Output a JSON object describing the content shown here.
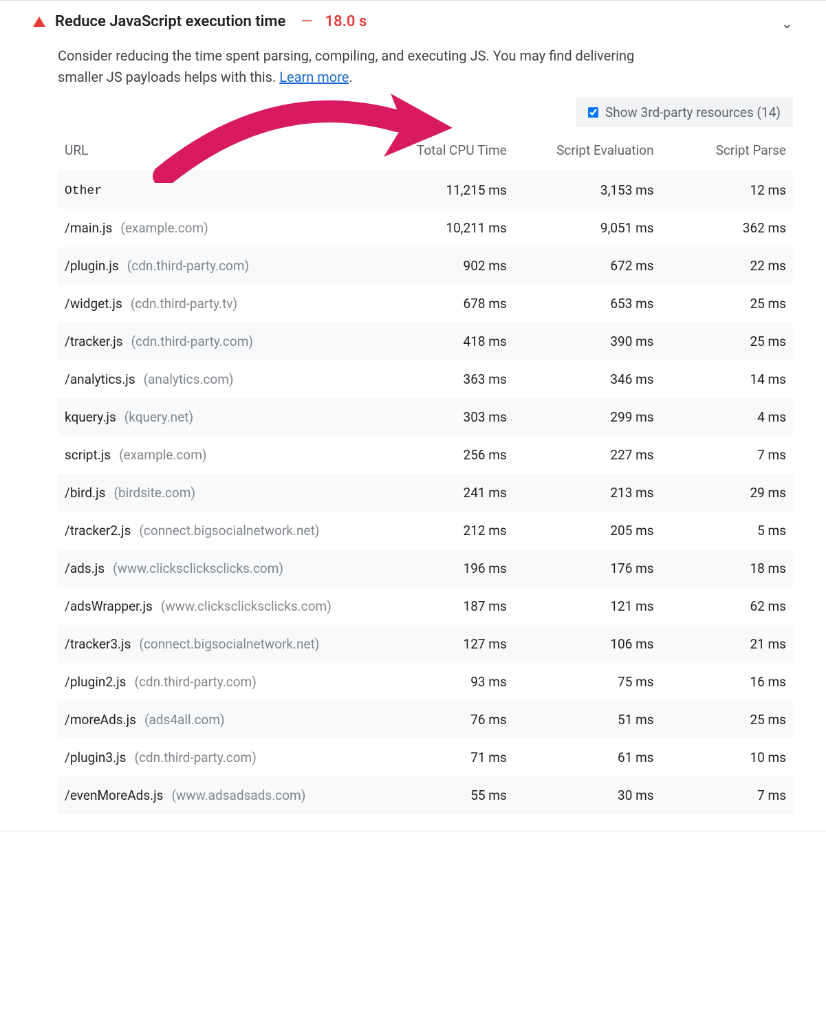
{
  "audit": {
    "title": "Reduce JavaScript execution time",
    "metric": "18.0 s",
    "description_pre": "Consider reducing the time spent parsing, compiling, and executing JS. You may find delivering smaller JS payloads helps with this. ",
    "learn_more": "Learn more",
    "toggle_label": "Show 3rd-party resources (14)"
  },
  "columns": {
    "url": "URL",
    "cpu": "Total CPU Time",
    "eval": "Script Evaluation",
    "parse": "Script Parse"
  },
  "rows": [
    {
      "path": "Other",
      "host": "",
      "mono": true,
      "cpu": "11,215 ms",
      "eval": "3,153 ms",
      "parse": "12 ms"
    },
    {
      "path": "/main.js",
      "host": "(example.com)",
      "cpu": "10,211 ms",
      "eval": "9,051 ms",
      "parse": "362 ms"
    },
    {
      "path": "/plugin.js",
      "host": "(cdn.third-party.com)",
      "cpu": "902 ms",
      "eval": "672 ms",
      "parse": "22 ms"
    },
    {
      "path": "/widget.js",
      "host": "(cdn.third-party.tv)",
      "cpu": "678 ms",
      "eval": "653 ms",
      "parse": "25 ms"
    },
    {
      "path": "/tracker.js",
      "host": "(cdn.third-party.com)",
      "cpu": "418 ms",
      "eval": "390 ms",
      "parse": "25 ms"
    },
    {
      "path": "/analytics.js",
      "host": "(analytics.com)",
      "cpu": "363 ms",
      "eval": "346 ms",
      "parse": "14 ms"
    },
    {
      "path": "kquery.js",
      "host": "(kquery.net)",
      "cpu": "303 ms",
      "eval": "299 ms",
      "parse": "4 ms"
    },
    {
      "path": "script.js",
      "host": "(example.com)",
      "cpu": "256 ms",
      "eval": "227 ms",
      "parse": "7 ms"
    },
    {
      "path": "/bird.js",
      "host": "(birdsite.com)",
      "cpu": "241 ms",
      "eval": "213 ms",
      "parse": "29 ms"
    },
    {
      "path": "/tracker2.js",
      "host": "(connect.bigsocialnetwork.net)",
      "cpu": "212 ms",
      "eval": "205 ms",
      "parse": "5 ms"
    },
    {
      "path": "/ads.js",
      "host": "(www.clicksclicksclicks.com)",
      "cpu": "196 ms",
      "eval": "176 ms",
      "parse": "18 ms"
    },
    {
      "path": "/adsWrapper.js",
      "host": "(www.clicksclicksclicks.com)",
      "cpu": "187 ms",
      "eval": "121 ms",
      "parse": "62 ms"
    },
    {
      "path": "/tracker3.js",
      "host": "(connect.bigsocialnetwork.net)",
      "cpu": "127 ms",
      "eval": "106 ms",
      "parse": "21 ms"
    },
    {
      "path": "/plugin2.js",
      "host": "(cdn.third-party.com)",
      "cpu": "93 ms",
      "eval": "75 ms",
      "parse": "16 ms"
    },
    {
      "path": "/moreAds.js",
      "host": "(ads4all.com)",
      "cpu": "76 ms",
      "eval": "51 ms",
      "parse": "25 ms"
    },
    {
      "path": "/plugin3.js",
      "host": "(cdn.third-party.com)",
      "cpu": "71 ms",
      "eval": "61 ms",
      "parse": "10 ms"
    },
    {
      "path": "/evenMoreAds.js",
      "host": "(www.adsadsads.com)",
      "cpu": "55 ms",
      "eval": "30 ms",
      "parse": "7 ms"
    }
  ]
}
